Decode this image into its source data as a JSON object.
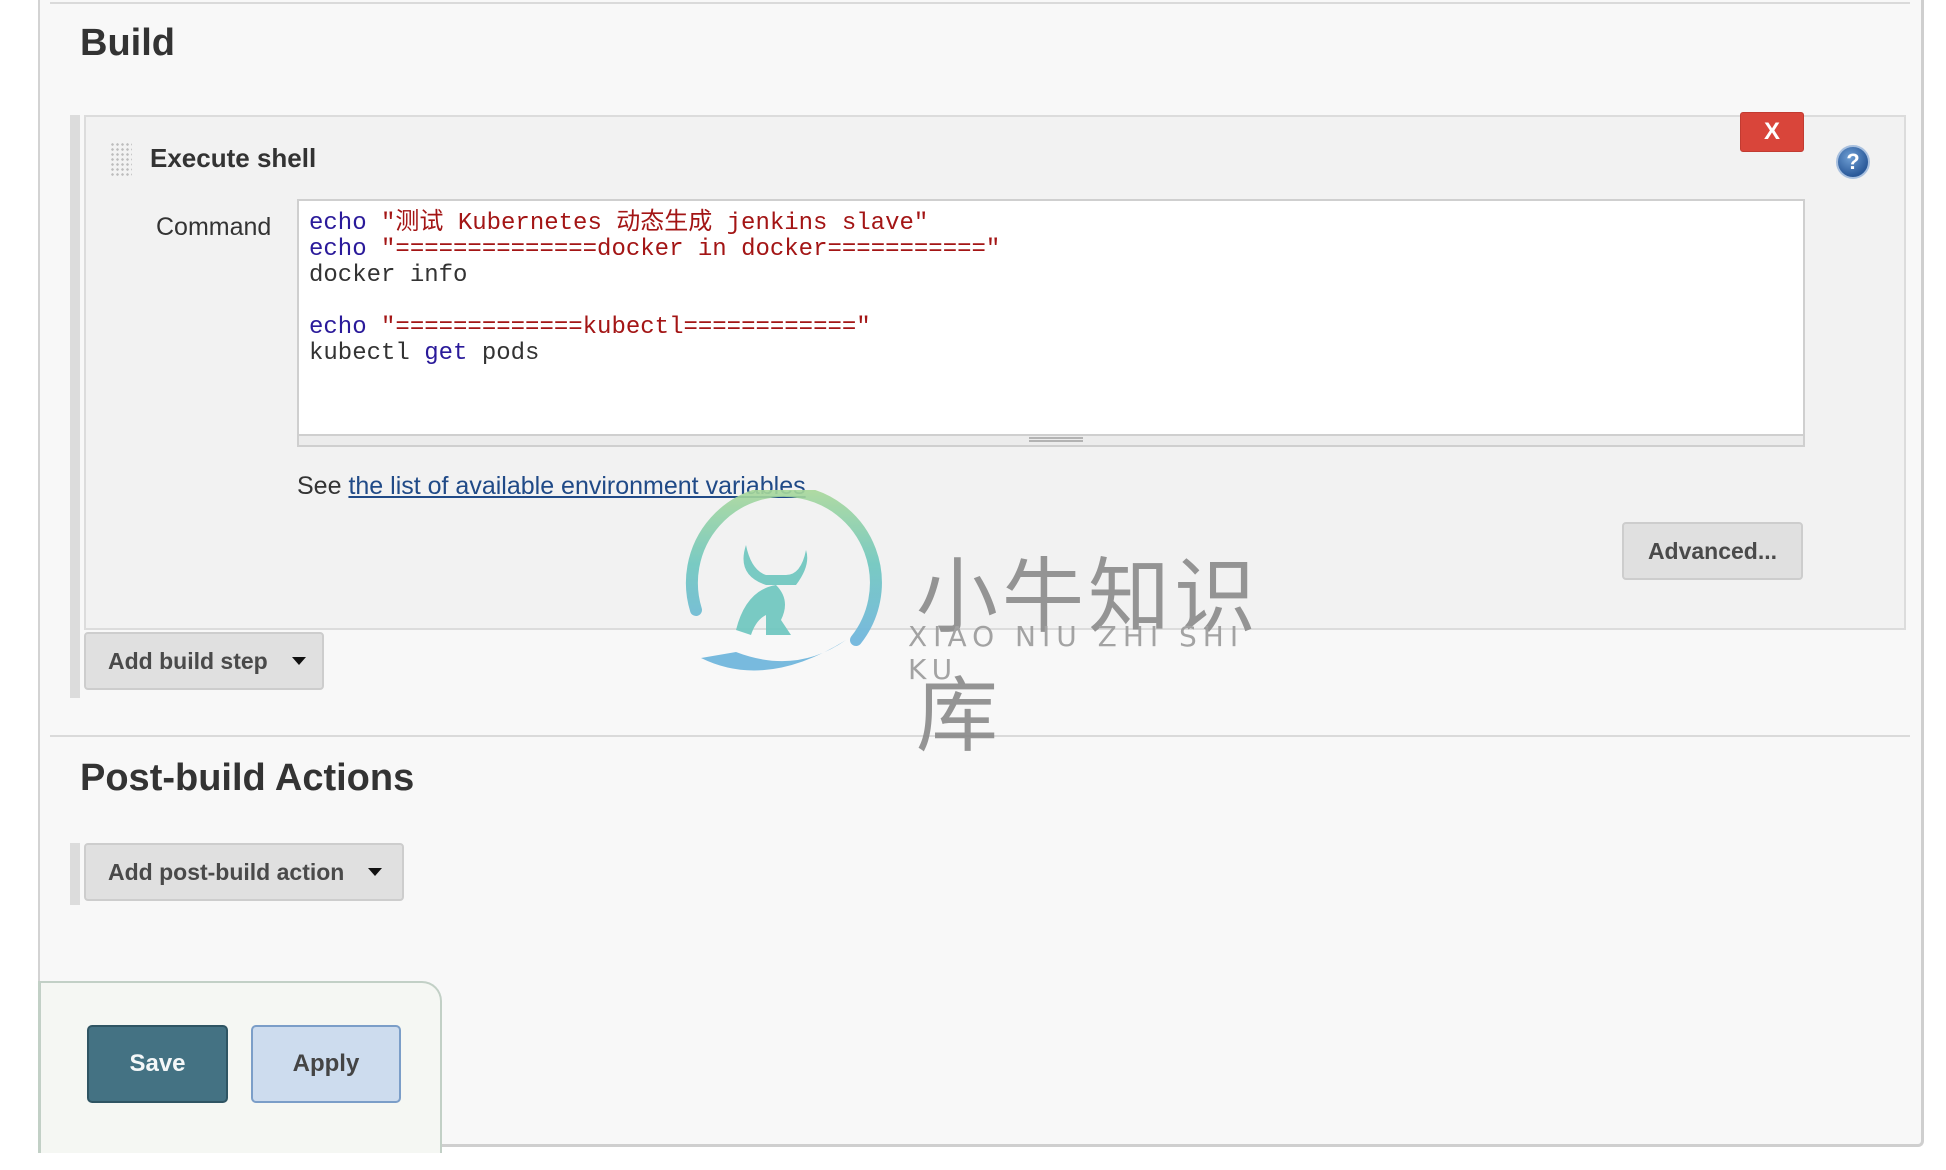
{
  "build": {
    "title": "Build",
    "step": {
      "title": "Execute shell",
      "delete_label": "X",
      "help_label": "?",
      "command_label": "Command",
      "command_lines": [
        [
          {
            "t": "kw",
            "v": "echo"
          },
          {
            "t": "plain",
            "v": " "
          },
          {
            "t": "str",
            "v": "\"测试 Kubernetes 动态生成 jenkins slave\""
          }
        ],
        [
          {
            "t": "kw",
            "v": "echo"
          },
          {
            "t": "plain",
            "v": " "
          },
          {
            "t": "str",
            "v": "\"==============docker in docker===========\""
          }
        ],
        [
          {
            "t": "plain",
            "v": "docker info"
          }
        ],
        [
          {
            "t": "plain",
            "v": ""
          }
        ],
        [
          {
            "t": "kw",
            "v": "echo"
          },
          {
            "t": "plain",
            "v": " "
          },
          {
            "t": "str",
            "v": "\"=============kubectl============\""
          }
        ],
        [
          {
            "t": "plain",
            "v": "kubectl "
          },
          {
            "t": "kw",
            "v": "get"
          },
          {
            "t": "plain",
            "v": " pods"
          }
        ]
      ],
      "env_prefix": "See ",
      "env_link": "the list of available environment variables",
      "advanced_label": "Advanced..."
    },
    "add_step_label": "Add build step"
  },
  "post_build": {
    "title": "Post-build Actions",
    "add_action_label": "Add post-build action"
  },
  "footer": {
    "save_label": "Save",
    "apply_label": "Apply"
  },
  "watermark": {
    "cn": "小牛知识库",
    "en": "XIAO NIU ZHI SHI KU"
  },
  "colors": {
    "delete": "#d9453a",
    "save": "#447283",
    "apply": "#cddcee",
    "keyword": "#2a1a9a",
    "string": "#a31515",
    "link": "#204a87"
  }
}
